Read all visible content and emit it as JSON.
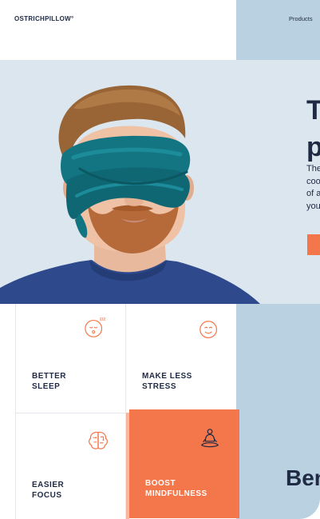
{
  "header": {
    "logo": "OSTRICHPILLOW°",
    "nav_products": "Products"
  },
  "hero": {
    "title_partial": "T\np",
    "text_partial": "The\ncoo\nof a\nyou"
  },
  "benefits": {
    "heading_partial": "Ben",
    "tiles": [
      {
        "label": "BETTER\nSLEEP",
        "icon": "sleeping-face-icon",
        "active": false
      },
      {
        "label": "MAKE LESS\nSTRESS",
        "icon": "smiling-face-icon",
        "active": false
      },
      {
        "label": "EASIER\nFOCUS",
        "icon": "brain-icon",
        "active": false
      },
      {
        "label": "BOOST\nMINDFULNESS",
        "icon": "meditation-icon",
        "active": true
      }
    ]
  },
  "colors": {
    "accent": "#f4774c",
    "light_blue": "#b9d1e1",
    "navy": "#1f2a44",
    "pillow_teal": "#137582"
  }
}
